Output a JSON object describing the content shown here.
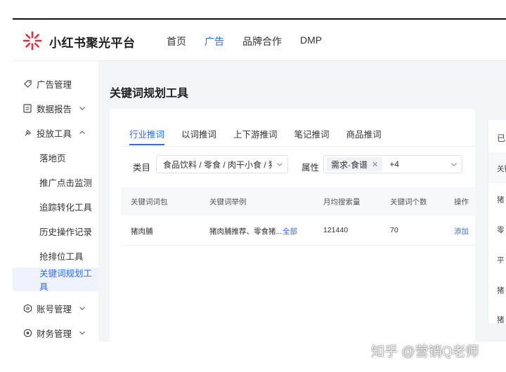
{
  "brand": {
    "name": "小红书聚光平台",
    "logo_icon": "starburst-icon",
    "logo_color": "#ff2442"
  },
  "nav": {
    "items": [
      "首页",
      "广告",
      "品牌合作",
      "DMP"
    ],
    "active_index": 1
  },
  "sidebar": {
    "groups": [
      {
        "label": "广告管理",
        "icon": "tag-icon"
      },
      {
        "label": "数据报告",
        "icon": "report-icon",
        "chevron": "down"
      },
      {
        "label": "投放工具",
        "icon": "tool-icon",
        "chevron": "up"
      }
    ],
    "sub_items": [
      "落地页",
      "推广点击监测",
      "追踪转化工具",
      "历史操作记录",
      "抢排位工具",
      "关键词规划工具"
    ],
    "active_sub_index": 5,
    "bottom_groups": [
      {
        "label": "账号管理",
        "icon": "account-icon",
        "chevron": "down"
      },
      {
        "label": "财务管理",
        "icon": "finance-icon",
        "chevron": "down"
      }
    ]
  },
  "page": {
    "title": "关键词规划工具"
  },
  "tabs": {
    "items": [
      "行业推词",
      "以词推词",
      "上下游推词",
      "笔记推词",
      "商品推词"
    ],
    "active_index": 0
  },
  "filters": {
    "category_label": "类目",
    "category_value": "食品饮料 / 零食 / 肉干小食 / 猪",
    "attribute_label": "属性",
    "attribute_tag": "需求-食谱",
    "attribute_more": "+4"
  },
  "table": {
    "columns": [
      "关键词词包",
      "关键词举例",
      "月均搜索量",
      "关键词个数",
      "操作"
    ],
    "rows": [
      {
        "package": "猪肉脯",
        "example": "猪肉脯推荐、零食猪...",
        "example_link": "全部",
        "monthly_search": "121440",
        "count": "70",
        "action": "添加"
      }
    ]
  },
  "right_panel": {
    "fragments": [
      "已",
      "关键",
      "猪",
      "零",
      "平",
      "猪",
      "猪"
    ]
  },
  "watermark": "知乎 @营销Q老师",
  "colors": {
    "accent": "#2f6bff",
    "brand_red": "#ff2442"
  }
}
